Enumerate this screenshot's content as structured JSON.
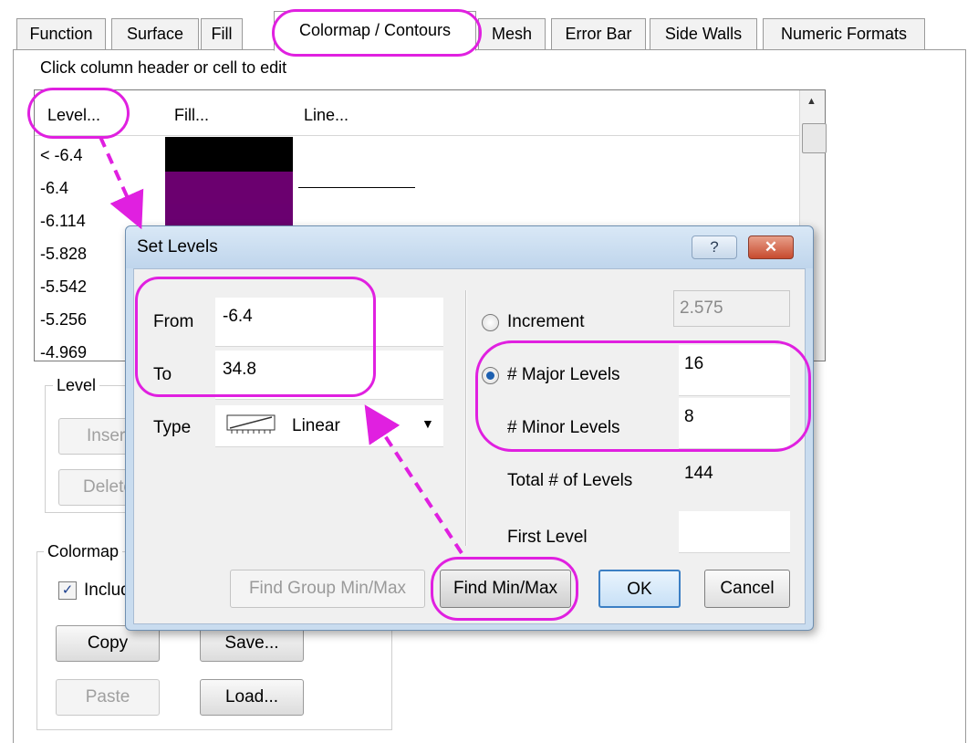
{
  "tabs": [
    {
      "label": "Function"
    },
    {
      "label": "Surface"
    },
    {
      "label": "Fill"
    },
    {
      "label": "Colormap / Contours"
    },
    {
      "label": "Mesh"
    },
    {
      "label": "Error Bar"
    },
    {
      "label": "Side Walls"
    },
    {
      "label": "Numeric Formats"
    }
  ],
  "hint": "Click column header or cell to edit",
  "grid": {
    "headers": {
      "level": "Level...",
      "fill": "Fill...",
      "line": "Line..."
    },
    "rows": [
      "< -6.4",
      "-6.4",
      "-6.114",
      "-5.828",
      "-5.542",
      "-5.256",
      "-4.969"
    ],
    "fill_colors": [
      "#000000",
      "#6b006f",
      "#6a0070"
    ]
  },
  "left_panel": {
    "level_label": "Level",
    "insert_label": "Insert",
    "delete_label": "Delete",
    "colormap_label": "Colormap",
    "include_label": "Include",
    "copy_label": "Copy",
    "save_label": "Save...",
    "paste_label": "Paste",
    "load_label": "Load..."
  },
  "dialog": {
    "title": "Set Levels",
    "help_glyph": "?",
    "from_label": "From",
    "from_value": "-6.4",
    "to_label": "To",
    "to_value": "34.8",
    "type_label": "Type",
    "type_value": "Linear",
    "increment_label": "Increment",
    "increment_value": "2.575",
    "major_label": "# Major Levels",
    "major_value": "16",
    "minor_label": "# Minor Levels",
    "minor_value": "8",
    "total_label": "Total # of Levels",
    "total_value": "144",
    "first_label": "First Level",
    "first_value": "",
    "btn_group_minmax": "Find Group Min/Max",
    "btn_minmax": "Find Min/Max",
    "btn_ok": "OK",
    "btn_cancel": "Cancel"
  },
  "colors": {
    "highlight": "#e020e0",
    "accent": "#1c5fb0"
  }
}
